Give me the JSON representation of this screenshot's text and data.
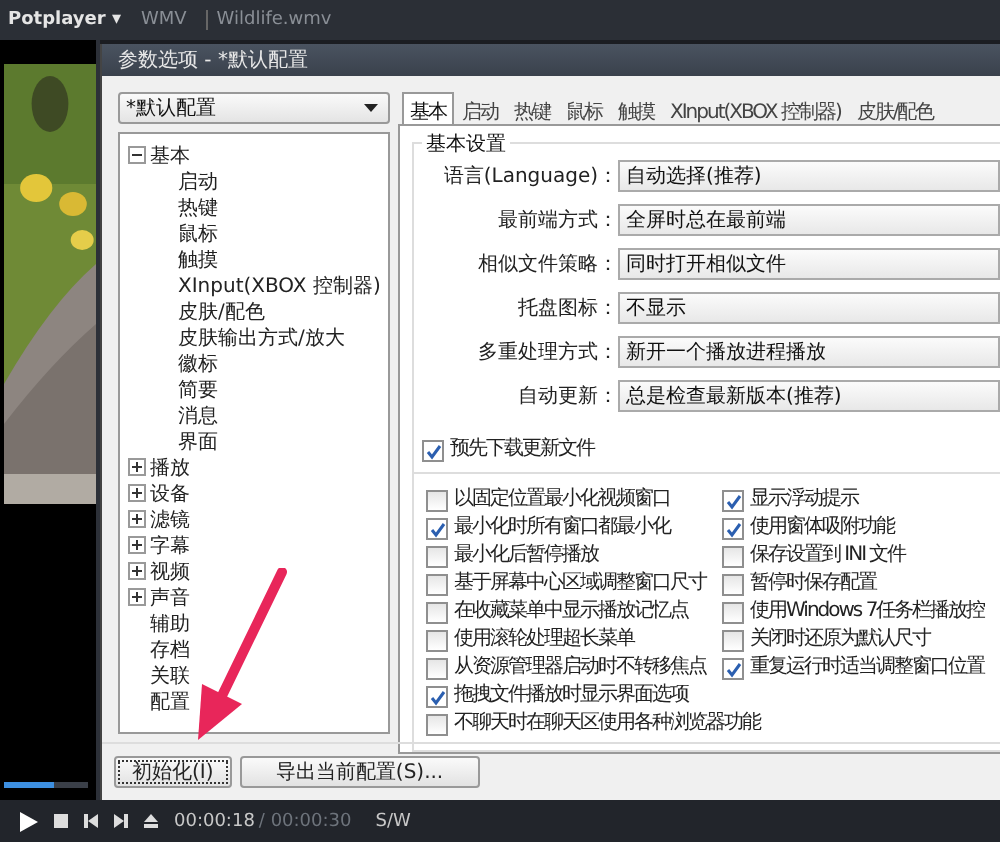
{
  "player": {
    "menu_label": "Potplayer ▾",
    "format": "WMV",
    "file": "Wildlife.wmv",
    "progress": {
      "level": 0.6
    },
    "time_current": "00:00:18",
    "time_total": "/ 00:00:30",
    "mode": "S/W"
  },
  "dialog": {
    "title": "参数选项 - *默认配置",
    "profile": "*默认配置",
    "tree": [
      {
        "label": "基本",
        "expanded": true,
        "children": [
          {
            "label": "启动"
          },
          {
            "label": "热键"
          },
          {
            "label": "鼠标"
          },
          {
            "label": "触摸"
          },
          {
            "label": "XInput(XBOX 控制器)"
          },
          {
            "label": "皮肤/配色"
          },
          {
            "label": "皮肤输出方式/放大"
          },
          {
            "label": "徽标"
          },
          {
            "label": "简要"
          },
          {
            "label": "消息"
          },
          {
            "label": "界面"
          }
        ]
      },
      {
        "label": "播放",
        "expanded": false
      },
      {
        "label": "设备",
        "expanded": false
      },
      {
        "label": "滤镜",
        "expanded": false
      },
      {
        "label": "字幕",
        "expanded": false
      },
      {
        "label": "视频",
        "expanded": false
      },
      {
        "label": "声音",
        "expanded": false
      },
      {
        "label": "辅助"
      },
      {
        "label": "存档"
      },
      {
        "label": "关联"
      },
      {
        "label": "配置"
      }
    ],
    "tabs": [
      {
        "label": "基本",
        "selected": true
      },
      {
        "label": "启动",
        "selected": false
      },
      {
        "label": "热键",
        "selected": false
      },
      {
        "label": "鼠标",
        "selected": false
      },
      {
        "label": "触摸",
        "selected": false
      },
      {
        "label": "XInput(XBOX 控制器)",
        "selected": false
      },
      {
        "label": "皮肤/配色",
        "selected": false
      }
    ],
    "group_title": "基本设置",
    "settings": [
      {
        "label": "语言(Language)：",
        "value": "自动选择(推荐)"
      },
      {
        "label": "最前端方式：",
        "value": "全屏时总在最前端"
      },
      {
        "label": "相似文件策略：",
        "value": "同时打开相似文件"
      },
      {
        "label": "托盘图标：",
        "value": "不显示"
      },
      {
        "label": "多重处理方式：",
        "value": "新开一个播放进程播放"
      },
      {
        "label": "自动更新：",
        "value": "总是检查最新版本(推荐)"
      }
    ],
    "update_option": {
      "label": "预先下载更新文件",
      "checked": true
    },
    "options_left": [
      {
        "label": "以固定位置最小化视频窗口",
        "checked": false
      },
      {
        "label": "最小化时所有窗口都最小化",
        "checked": true
      },
      {
        "label": "最小化后暂停播放",
        "checked": false
      },
      {
        "label": "基于屏幕中心区域调整窗口尺寸",
        "checked": false
      },
      {
        "label": "在收藏菜单中显示播放记忆点",
        "checked": false
      },
      {
        "label": "使用滚轮处理超长菜单",
        "checked": false
      },
      {
        "label": "从资源管理器启动时不转移焦点",
        "checked": false
      },
      {
        "label": "拖拽文件播放时显示界面选项",
        "checked": true
      },
      {
        "label": "不聊天时在聊天区使用各种浏览器功能",
        "checked": false
      }
    ],
    "options_right": [
      {
        "label": "显示浮动提示",
        "checked": true
      },
      {
        "label": "使用窗体吸附功能",
        "checked": true
      },
      {
        "label": "保存设置到 INI 文件",
        "checked": false
      },
      {
        "label": "暂停时保存配置",
        "checked": false
      },
      {
        "label": "使用Windows 7任务栏播放控",
        "checked": false
      },
      {
        "label": "关闭时还原为默认尺寸",
        "checked": false
      },
      {
        "label": "重复运行时适当调整窗口位置",
        "checked": true
      }
    ],
    "buttons": [
      "初始化(I)",
      "导出当前配置(S)..."
    ]
  }
}
